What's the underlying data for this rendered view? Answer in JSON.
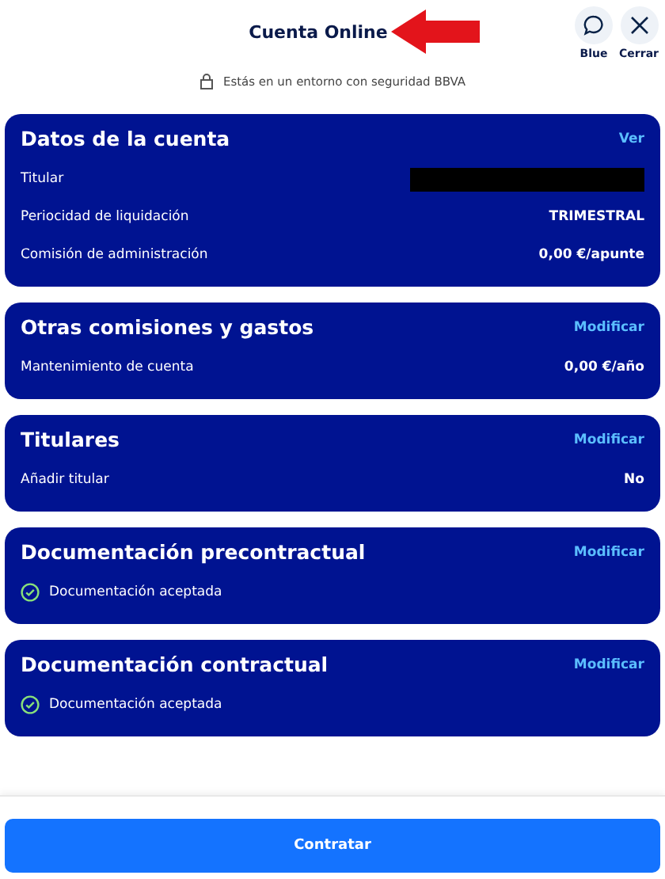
{
  "header": {
    "title": "Cuenta Online",
    "actions": [
      {
        "kind": "chat",
        "label": "Blue"
      },
      {
        "kind": "close",
        "label": "Cerrar"
      }
    ]
  },
  "security_note": "Estás en un entorno con seguridad BBVA",
  "cards": [
    {
      "title": "Datos de la cuenta",
      "action": "Ver",
      "rows": [
        {
          "kind": "redacted",
          "label": "Titular"
        },
        {
          "kind": "value",
          "label": "Periocidad de liquidación",
          "value": "TRIMESTRAL"
        },
        {
          "kind": "value",
          "label": "Comisión de administración",
          "value": "0,00 €/apunte"
        }
      ]
    },
    {
      "title": "Otras comisiones y gastos",
      "action": "Modificar",
      "rows": [
        {
          "kind": "value",
          "label": "Mantenimiento de cuenta",
          "value": "0,00 €/año"
        }
      ]
    },
    {
      "title": "Titulares",
      "action": "Modificar",
      "rows": [
        {
          "kind": "value",
          "label": "Añadir titular",
          "value": "No"
        }
      ]
    },
    {
      "title": "Documentación precontractual",
      "action": "Modificar",
      "rows": [
        {
          "kind": "check",
          "label": "Documentación aceptada"
        }
      ]
    },
    {
      "title": "Documentación contractual",
      "action": "Modificar",
      "rows": [
        {
          "kind": "check",
          "label": "Documentación aceptada"
        }
      ]
    }
  ],
  "primary_button": "Contratar"
}
